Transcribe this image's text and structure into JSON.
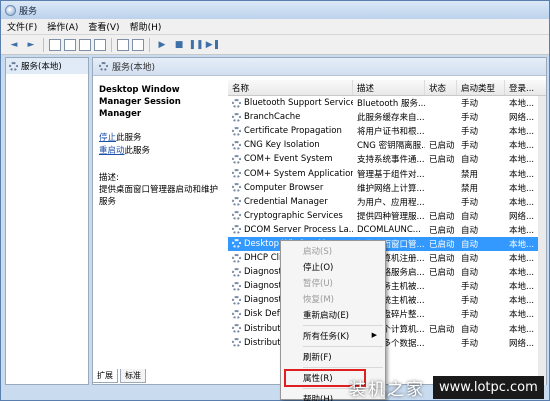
{
  "window": {
    "title": "服务"
  },
  "menubar": [
    "文件(F)",
    "操作(A)",
    "查看(V)",
    "帮助(H)"
  ],
  "toolbar": {
    "back": "◄",
    "forward": "►",
    "play": "▶",
    "stop": "■",
    "pause": "❚❚",
    "restart": "▶❚"
  },
  "left_pane": {
    "tree_root": "服务(本地)"
  },
  "right_pane": {
    "header": "服务(本地)",
    "description": {
      "title": "Desktop Window Manager Session Manager",
      "stop_link": "停止",
      "stop_suffix": "此服务",
      "restart_link": "重启动",
      "restart_suffix": "此服务",
      "label": "描述:",
      "text": "提供桌面窗口管理器启动和维护服务"
    },
    "columns": [
      "名称",
      "描述",
      "状态",
      "启动类型",
      "登录..."
    ],
    "rows": [
      {
        "name": "Bluetooth Support Service",
        "desc": "Bluetooth 服务...",
        "state": "",
        "start": "手动",
        "logon": "本地..."
      },
      {
        "name": "BranchCache",
        "desc": "此服务缓存来自...",
        "state": "",
        "start": "手动",
        "logon": "网络..."
      },
      {
        "name": "Certificate Propagation",
        "desc": "将用户证书和根...",
        "state": "",
        "start": "手动",
        "logon": "本地..."
      },
      {
        "name": "CNG Key Isolation",
        "desc": "CNG 密钥隔离服...",
        "state": "已启动",
        "start": "手动",
        "logon": "本地..."
      },
      {
        "name": "COM+ Event System",
        "desc": "支持系统事件通...",
        "state": "已启动",
        "start": "自动",
        "logon": "本地..."
      },
      {
        "name": "COM+ System Application",
        "desc": "管理基于组件对...",
        "state": "",
        "start": "禁用",
        "logon": "本地..."
      },
      {
        "name": "Computer Browser",
        "desc": "维护网络上计算...",
        "state": "",
        "start": "禁用",
        "logon": "本地..."
      },
      {
        "name": "Credential Manager",
        "desc": "为用户、应用程...",
        "state": "",
        "start": "手动",
        "logon": "本地..."
      },
      {
        "name": "Cryptographic Services",
        "desc": "提供四种管理服...",
        "state": "已启动",
        "start": "自动",
        "logon": "网络..."
      },
      {
        "name": "DCOM Server Process La...",
        "desc": "DCOMLAUNC...",
        "state": "已启动",
        "start": "自动",
        "logon": "本地..."
      },
      {
        "name": "Desktop Window Manager...",
        "desc": "提供桌面窗口管...",
        "state": "已启动",
        "start": "自动",
        "logon": "本地...",
        "selected": true
      },
      {
        "name": "DHCP Client",
        "desc": "为此计算机注册...",
        "state": "已启动",
        "start": "自动",
        "logon": "本地..."
      },
      {
        "name": "Diagnostic Policy Service",
        "desc": "诊断策略服务启...",
        "state": "已启动",
        "start": "自动",
        "logon": "本地..."
      },
      {
        "name": "Diagnostic Service Host",
        "desc": "诊断服务主机被...",
        "state": "",
        "start": "手动",
        "logon": "本地..."
      },
      {
        "name": "Diagnostic System Host",
        "desc": "诊断系统主机被...",
        "state": "",
        "start": "手动",
        "logon": "本地..."
      },
      {
        "name": "Disk Defragmenter",
        "desc": "提供磁盘碎片整...",
        "state": "",
        "start": "手动",
        "logon": "本地..."
      },
      {
        "name": "Distributed Link Tracking",
        "desc": "维护某个计算机...",
        "state": "已启动",
        "start": "自动",
        "logon": "本地..."
      },
      {
        "name": "Distributed Transaction",
        "desc": "协调跨多个数据...",
        "state": "",
        "start": "手动",
        "logon": "网络..."
      }
    ]
  },
  "tabs": [
    "扩展",
    "标准"
  ],
  "context_menu": {
    "items": [
      {
        "label": "启动(S)",
        "disabled": true
      },
      {
        "label": "停止(O)",
        "disabled": false
      },
      {
        "label": "暂停(U)",
        "disabled": true
      },
      {
        "label": "恢复(M)",
        "disabled": true
      },
      {
        "label": "重新启动(E)",
        "disabled": false
      },
      {
        "sep": true
      },
      {
        "label": "所有任务(K)",
        "disabled": false,
        "submenu": true
      },
      {
        "sep": true
      },
      {
        "label": "刷新(F)",
        "disabled": false
      },
      {
        "sep": true
      },
      {
        "label": "属性(R)",
        "disabled": false,
        "highlight": true
      },
      {
        "sep": true
      },
      {
        "label": "帮助(H)",
        "disabled": false
      }
    ],
    "submenu_arrow": "▶"
  },
  "watermark": {
    "cn": "装机之家",
    "url": "www.lotpc.com"
  }
}
